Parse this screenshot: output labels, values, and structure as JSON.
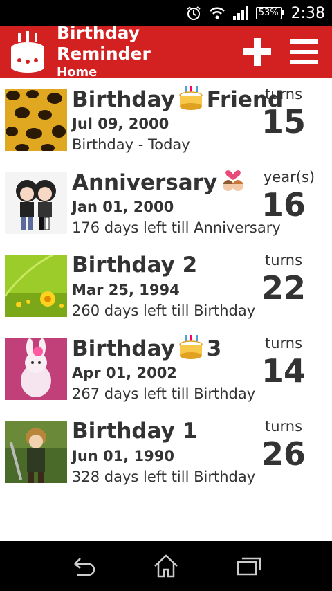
{
  "status": {
    "battery": "53%",
    "time": "2:38"
  },
  "header": {
    "title": "Birthday Reminder",
    "subtitle": "Home"
  },
  "events": [
    {
      "title_pre": "Birthday",
      "title_post": "Friend",
      "date": "Jul 09, 2000",
      "info": "Birthday - Today",
      "age_label": "turns",
      "age": "15"
    },
    {
      "title_pre": "Anniversary",
      "title_post": "",
      "date": "Jan 01, 2000",
      "info": "176 days left till Anniversary",
      "age_label": "year(s)",
      "age": "16"
    },
    {
      "title_pre": "Birthday 2",
      "title_post": "",
      "date": "Mar 25, 1994",
      "info": "260 days left till Birthday",
      "age_label": "turns",
      "age": "22"
    },
    {
      "title_pre": "Birthday",
      "title_post": "3",
      "date": "Apr 01, 2002",
      "info": "267 days left till Birthday",
      "age_label": "turns",
      "age": "14"
    },
    {
      "title_pre": "Birthday 1",
      "title_post": "",
      "date": "Jun 01, 1990",
      "info": "328 days left till Birthday",
      "age_label": "turns",
      "age": "26"
    }
  ],
  "colors": {
    "accent": "#d32020"
  }
}
